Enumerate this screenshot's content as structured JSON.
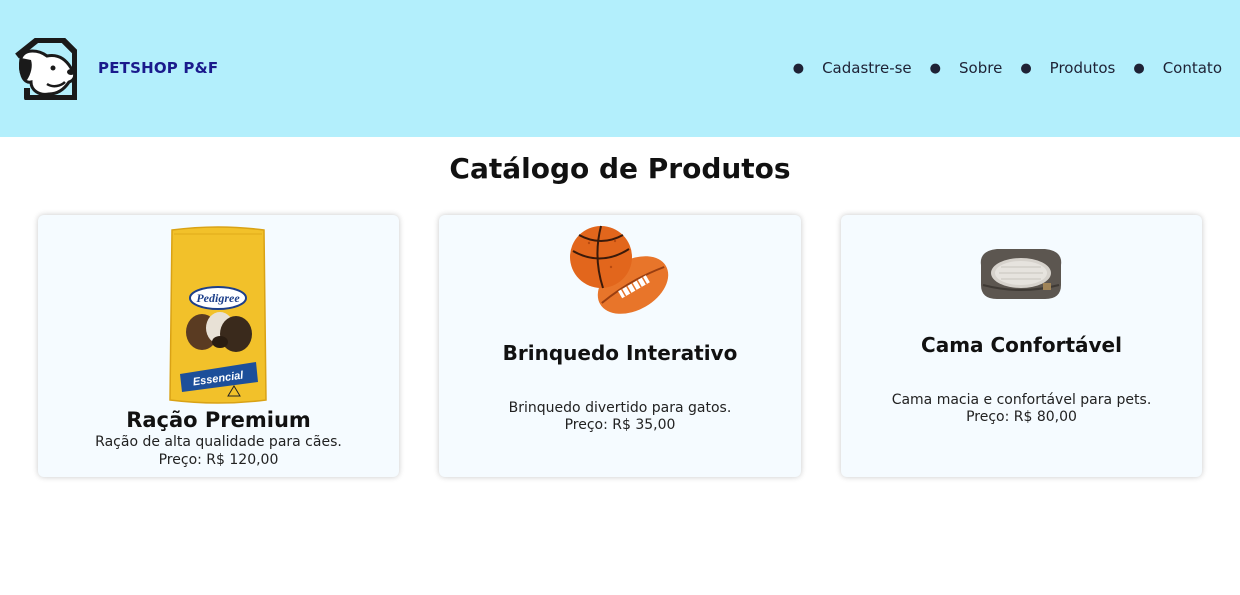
{
  "header": {
    "brand": "PETSHOP P&F",
    "nav": [
      {
        "label": "Cadastre-se"
      },
      {
        "label": "Sobre"
      },
      {
        "label": "Produtos"
      },
      {
        "label": "Contato"
      }
    ],
    "logo_icon": "dog-house-icon"
  },
  "main": {
    "title": "Catálogo de Produtos",
    "products": [
      {
        "name": "Ração Premium",
        "description": "Ração de alta qualidade para cães.",
        "price": "Preço: R$ 120,00",
        "image_icon": "dog-food-bag-image",
        "brand_text": "Pedigree",
        "label_text": "Essencial"
      },
      {
        "name": "Brinquedo Interativo",
        "description": "Brinquedo divertido para gatos.",
        "price": "Preço: R$ 35,00",
        "image_icon": "toy-balls-image"
      },
      {
        "name": "Cama Confortável",
        "description": "Cama macia e confortável para pets.",
        "price": "Preço: R$ 80,00",
        "image_icon": "pet-bed-image"
      }
    ]
  },
  "colors": {
    "header_bg": "#b3effc",
    "brand_text": "#1a1a8c",
    "card_bg": "#f5fbff"
  }
}
